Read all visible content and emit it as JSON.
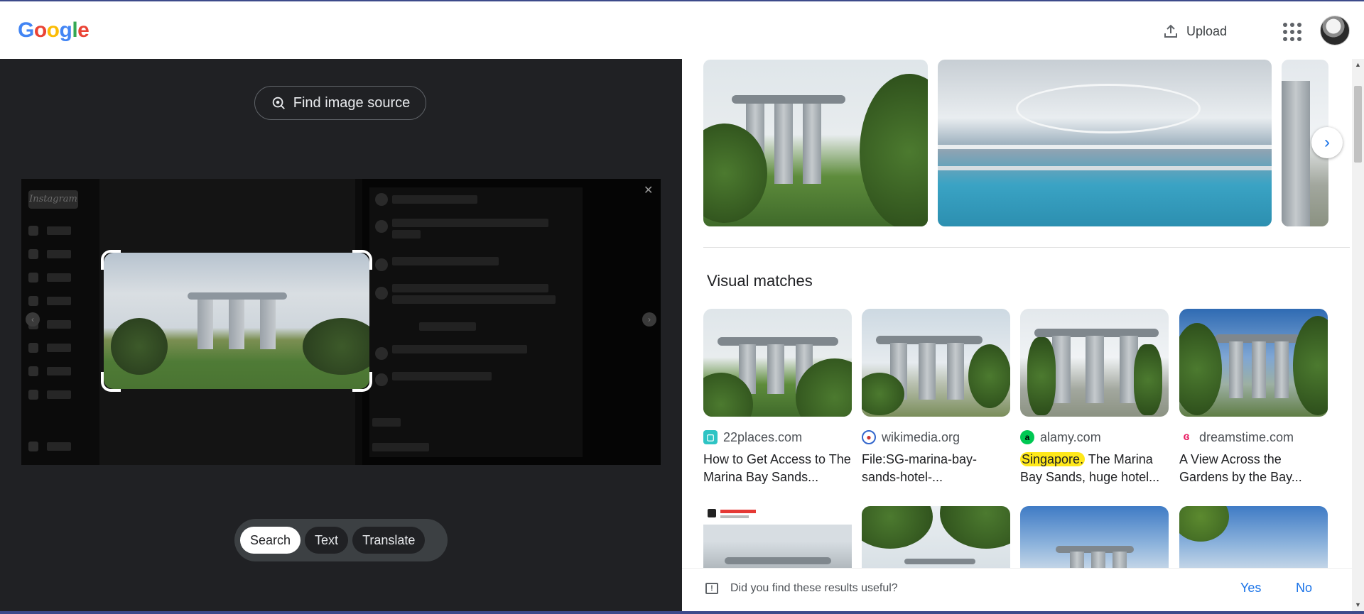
{
  "header": {
    "logo_letters": [
      {
        "ch": "G",
        "color": "#4285F4"
      },
      {
        "ch": "o",
        "color": "#EA4335"
      },
      {
        "ch": "o",
        "color": "#FBBC05"
      },
      {
        "ch": "g",
        "color": "#4285F4"
      },
      {
        "ch": "l",
        "color": "#34A853"
      },
      {
        "ch": "e",
        "color": "#EA4335"
      }
    ],
    "upload_label": "Upload"
  },
  "left_panel": {
    "find_source_label": "Find image source",
    "modes": [
      "Search",
      "Text",
      "Translate"
    ],
    "active_mode": "Search"
  },
  "right_panel": {
    "visual_matches_title": "Visual matches",
    "matches": [
      {
        "source": "22places.com",
        "favicon": "22places-icon",
        "favicon_color": "#2ec4c4",
        "title": "How to Get Access to The Marina Bay Sands...",
        "highlight": ""
      },
      {
        "source": "wikimedia.org",
        "favicon": "wikimedia-icon",
        "favicon_color": "#3366cc",
        "title": "File:SG-marina-bay-sands-hotel-...",
        "highlight": ""
      },
      {
        "source": "alamy.com",
        "favicon": "alamy-icon",
        "favicon_color": "#00c853",
        "title": "The Marina Bay Sands, huge hotel...",
        "highlight": "Singapore."
      },
      {
        "source": "dreamstime.com",
        "favicon": "dreamstime-icon",
        "favicon_color": "#e91e63",
        "title": "A View Across the Gardens by the Bay...",
        "highlight": ""
      }
    ],
    "feedback": {
      "question": "Did you find these results useful?",
      "yes": "Yes",
      "no": "No"
    }
  }
}
